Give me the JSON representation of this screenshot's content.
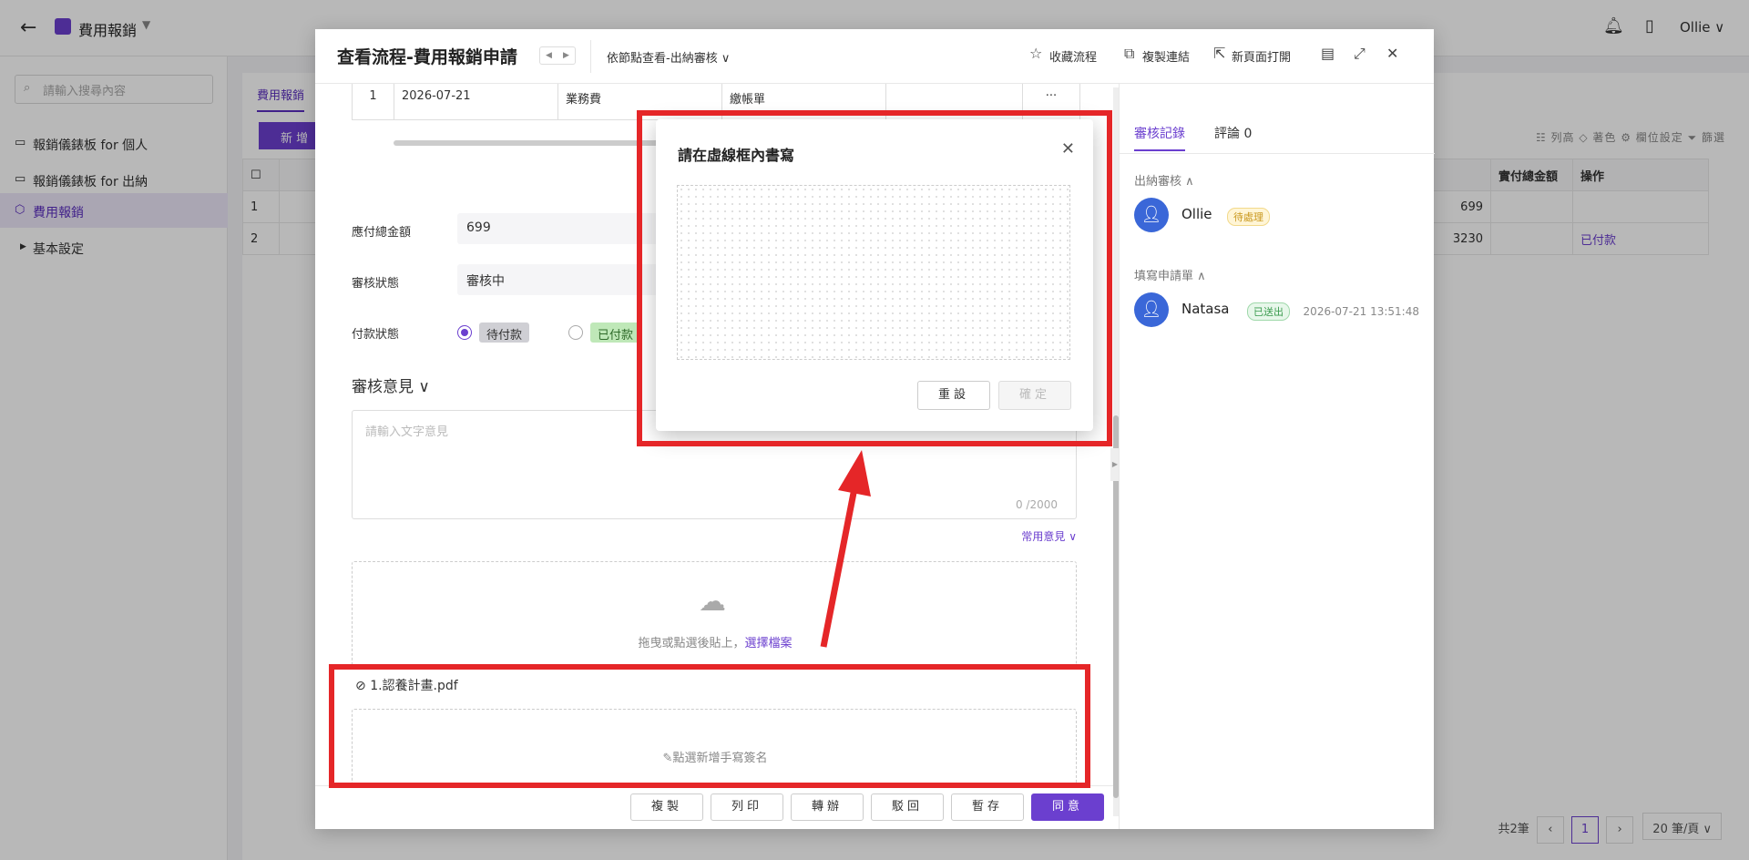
{
  "app": {
    "title": "費用報銷",
    "user": "Ollie ∨"
  },
  "sidebar": {
    "search_placeholder": "請輸入搜尋內容",
    "items": [
      {
        "label": "報銷儀錶板 for 個人"
      },
      {
        "label": "報銷儀錶板 for 出納"
      },
      {
        "label": "費用報銷"
      },
      {
        "label": "基本設定"
      }
    ]
  },
  "main": {
    "tab": "費用報銷",
    "new_button": "新 增",
    "tools": "☷ 列高   ◇ 著色   ⚙ 欄位設定   ⏷ 篩選",
    "columns": [
      "",
      "",
      "實付總金額",
      "操作"
    ],
    "rows": [
      {
        "no": "1",
        "amount": "699",
        "op": ""
      },
      {
        "no": "2",
        "amount": "3230",
        "op": "已付款"
      }
    ],
    "pager": {
      "total": "共2筆",
      "current": "1",
      "size": "20 筆/頁 ∨"
    }
  },
  "drawer": {
    "title": "查看流程-費用報銷申請",
    "view_select": "依節點查看-出納審核 ∨",
    "actions": {
      "favorite": "收藏流程",
      "copy_link": "複製連結",
      "open_new": "新頁面打開"
    },
    "detail_row": [
      "1",
      "2026-07-21",
      "業務費",
      "繳帳單",
      "",
      "···"
    ],
    "fields": [
      {
        "label": "應付總金額",
        "value": "699"
      },
      {
        "label": "審核狀態",
        "value": "審核中"
      }
    ],
    "payment": {
      "label": "付款狀態",
      "opt1": "待付款",
      "opt2": "已付款"
    },
    "review": {
      "title": "審核意見 ∨",
      "placeholder": "請輸入文字意見",
      "count": "0 /2000",
      "common": "常用意見 ∨"
    },
    "upload": {
      "text": "拖曳或點選後貼上，",
      "link": "選擇檔案"
    },
    "attachment": "1.認養計畫.pdf",
    "sign_prompt": "✎點選新增手寫簽名",
    "footer": {
      "copy": "複製",
      "print": "列印",
      "transfer": "轉辦",
      "reject": "駁回",
      "save": "暫存",
      "approve": "同意"
    }
  },
  "right_panel": {
    "tabs": {
      "records": "審核記錄",
      "comments": "評論 0"
    },
    "groups": [
      {
        "title": "出納審核 ∧",
        "user": "Ollie",
        "badge": "待處理"
      },
      {
        "title": "填寫申請單 ∧",
        "user": "Natasa",
        "badge": "已送出",
        "time": "2026-07-21 13:51:48"
      }
    ]
  },
  "modal": {
    "title": "請在虛線框內書寫",
    "reset": "重設",
    "confirm": "確定"
  },
  "colors": {
    "accent": "#6b3fcf",
    "annotation": "#e52628"
  }
}
